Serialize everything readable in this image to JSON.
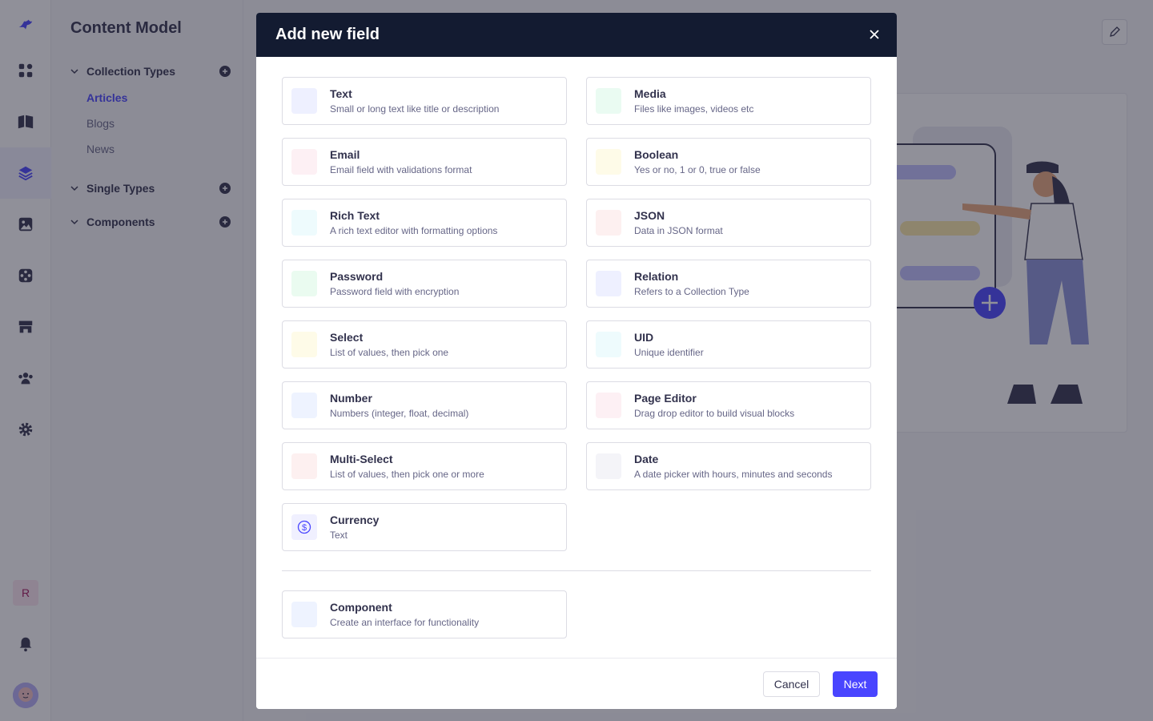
{
  "sidebar": {
    "title": "Content Model",
    "groups": [
      {
        "label": "Collection Types",
        "items": [
          "Articles",
          "Blogs",
          "News"
        ],
        "active_item": "Articles"
      },
      {
        "label": "Single Types",
        "items": []
      },
      {
        "label": "Components",
        "items": []
      }
    ]
  },
  "rail": {
    "icons": [
      "strapi-logo-icon",
      "dashboard-icon",
      "book-icon",
      "layers-icon",
      "image-icon",
      "puzzle-icon",
      "store-icon",
      "users-icon",
      "gear-icon"
    ],
    "avatar_initial": "R",
    "bell": "bell-icon",
    "user": "user-avatar"
  },
  "modal": {
    "title": "Add new field",
    "fields": [
      {
        "name": "Text",
        "description": "Small or long text like title or description",
        "color": "#eef0ff"
      },
      {
        "name": "Media",
        "description": "Files like images, videos etc",
        "color": "#eafbf2"
      },
      {
        "name": "Email",
        "description": "Email field with validations format",
        "color": "#fdf0f4"
      },
      {
        "name": "Boolean",
        "description": "Yes or no, 1 or 0, true or false",
        "color": "#fefbe8"
      },
      {
        "name": "Rich Text",
        "description": "A rich text editor with formatting options",
        "color": "#eefbfd"
      },
      {
        "name": "JSON",
        "description": "Data in JSON format",
        "color": "#fdf0f0"
      },
      {
        "name": "Password",
        "description": "Password field with encryption",
        "color": "#eafbf0"
      },
      {
        "name": "Relation",
        "description": "Refers to a Collection Type",
        "color": "#eef0ff"
      },
      {
        "name": "Select",
        "description": "List of values, then pick one",
        "color": "#fefbe8"
      },
      {
        "name": "UID",
        "description": "Unique identifier",
        "color": "#eefbfd"
      },
      {
        "name": "Number",
        "description": "Numbers (integer, float, decimal)",
        "color": "#eef3ff"
      },
      {
        "name": "Page Editor",
        "description": "Drag drop editor to build visual blocks",
        "color": "#fdf0f4"
      },
      {
        "name": "Multi-Select",
        "description": "List of values, then pick one or more",
        "color": "#fdf0f0"
      },
      {
        "name": "Date",
        "description": "A date picker with hours, minutes and seconds",
        "color": "#f4f4f8"
      },
      {
        "name": "Currency",
        "description": "Text",
        "color": "#f0f0ff"
      }
    ],
    "component": {
      "name": "Component",
      "description": "Create an interface for functionality",
      "color": "#eef3ff"
    },
    "cancel_label": "Cancel",
    "next_label": "Next"
  }
}
